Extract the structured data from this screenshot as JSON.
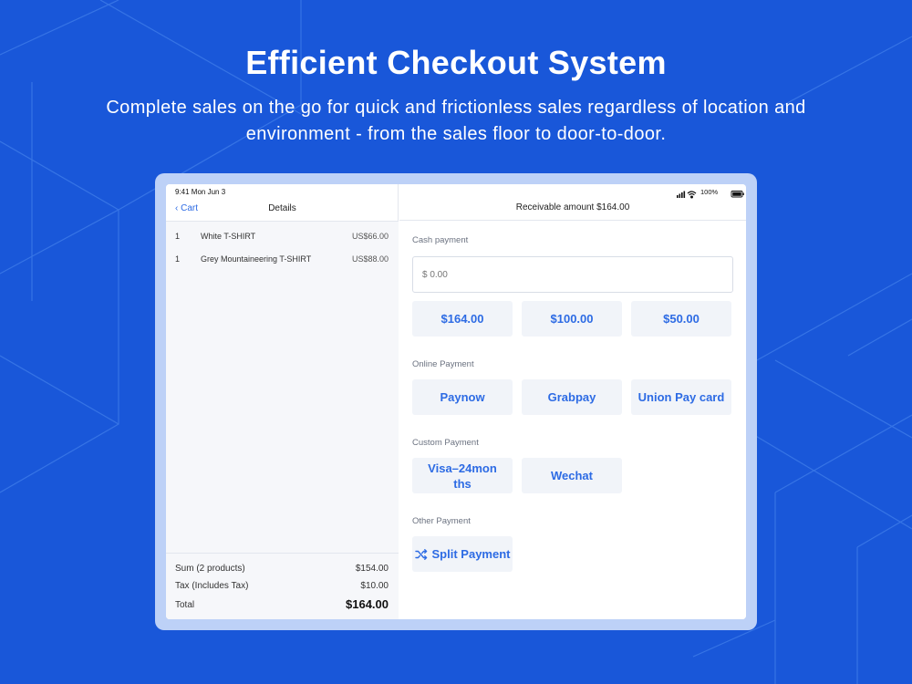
{
  "headline": "Efficient Checkout System",
  "subheadline": "Complete sales on the go for quick and frictionless sales regardless of location and environment - from the sales floor to door-to-door.",
  "status_bar": {
    "time_date": "9:41  Mon Jun 3",
    "battery": "100%"
  },
  "left_nav": {
    "back_label": "Cart",
    "title": "Details"
  },
  "items": [
    {
      "qty": "1",
      "name": "White T-SHIRT",
      "price": "US$66.00"
    },
    {
      "qty": "1",
      "name": "Grey Mountaineering T-SHIRT",
      "price": "US$88.00"
    }
  ],
  "summary": {
    "sum_label": "Sum (2 products)",
    "sum_value": "$154.00",
    "tax_label": "Tax (Includes Tax)",
    "tax_value": "$10.00",
    "total_label": "Total",
    "total_value": "$164.00"
  },
  "receivable": "Receivable amount $164.00",
  "cash": {
    "label": "Cash payment",
    "placeholder": "$ 0.00",
    "quick_amounts": [
      "$164.00",
      "$100.00",
      "$50.00"
    ]
  },
  "online": {
    "label": "Online Payment",
    "options": [
      "Paynow",
      "Grabpay",
      "Union Pay card"
    ]
  },
  "custom": {
    "label": "Custom Payment",
    "options": [
      "Visa–24mon ths",
      "Wechat"
    ]
  },
  "other": {
    "label": "Other Payment",
    "split_label": "Split Payment"
  },
  "colors": {
    "background": "#1957d9",
    "accent": "#2d6be4",
    "button_bg": "#f1f4f9"
  },
  "icons": {
    "back": "chevron-left-icon",
    "split": "shuffle-icon",
    "signal": "cellular-signal-icon",
    "wifi": "wifi-icon",
    "battery": "battery-icon"
  }
}
